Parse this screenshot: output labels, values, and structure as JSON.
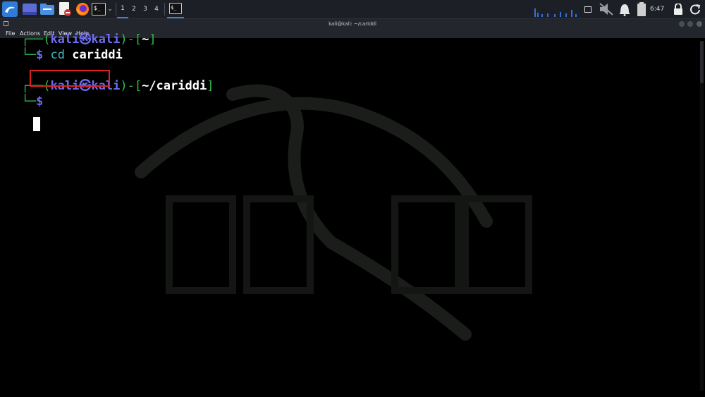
{
  "window": {
    "title": "kali@kali: ~/cariddi"
  },
  "menubar": {
    "items": [
      "File",
      "Actions",
      "Edit",
      "View",
      "Help"
    ]
  },
  "taskbar": {
    "workspaces": [
      "1",
      "2",
      "3",
      "4"
    ],
    "clock": "6:47",
    "icons": [
      "kali-menu-icon",
      "desktop-icon",
      "file-manager-icon",
      "text-editor-icon",
      "firefox-icon",
      "terminal-icon",
      "chevron-down-icon",
      "terminal-window-icon",
      "cpu-graph-icon",
      "display-icon",
      "muted-speaker-icon",
      "notification-bell-icon",
      "battery-icon",
      "lock-icon",
      "power-icon"
    ]
  },
  "terminal": {
    "prompt1": {
      "open": "┌──(",
      "user": "kali",
      "at": "㉿",
      "host": "kali",
      "mid": ")-[",
      "path": "~",
      "close": "]"
    },
    "cmd1": {
      "branch": "└─",
      "dollar": "$",
      "cmd": "cd",
      "arg": "cariddi"
    },
    "prompt2": {
      "open": "┌──(",
      "user": "kali",
      "at": "㉿",
      "host": "kali",
      "mid": ")-[",
      "path": "~/cariddi",
      "close": "]"
    },
    "cmd2": {
      "branch": "└─",
      "dollar": "$"
    }
  },
  "colors": {
    "prompt_green": "#2fbf4a",
    "user_blue": "#6e6cf0",
    "command_cyan": "#3fb9c0",
    "highlight_red": "#e02020",
    "terminal_bg": "#000000"
  }
}
